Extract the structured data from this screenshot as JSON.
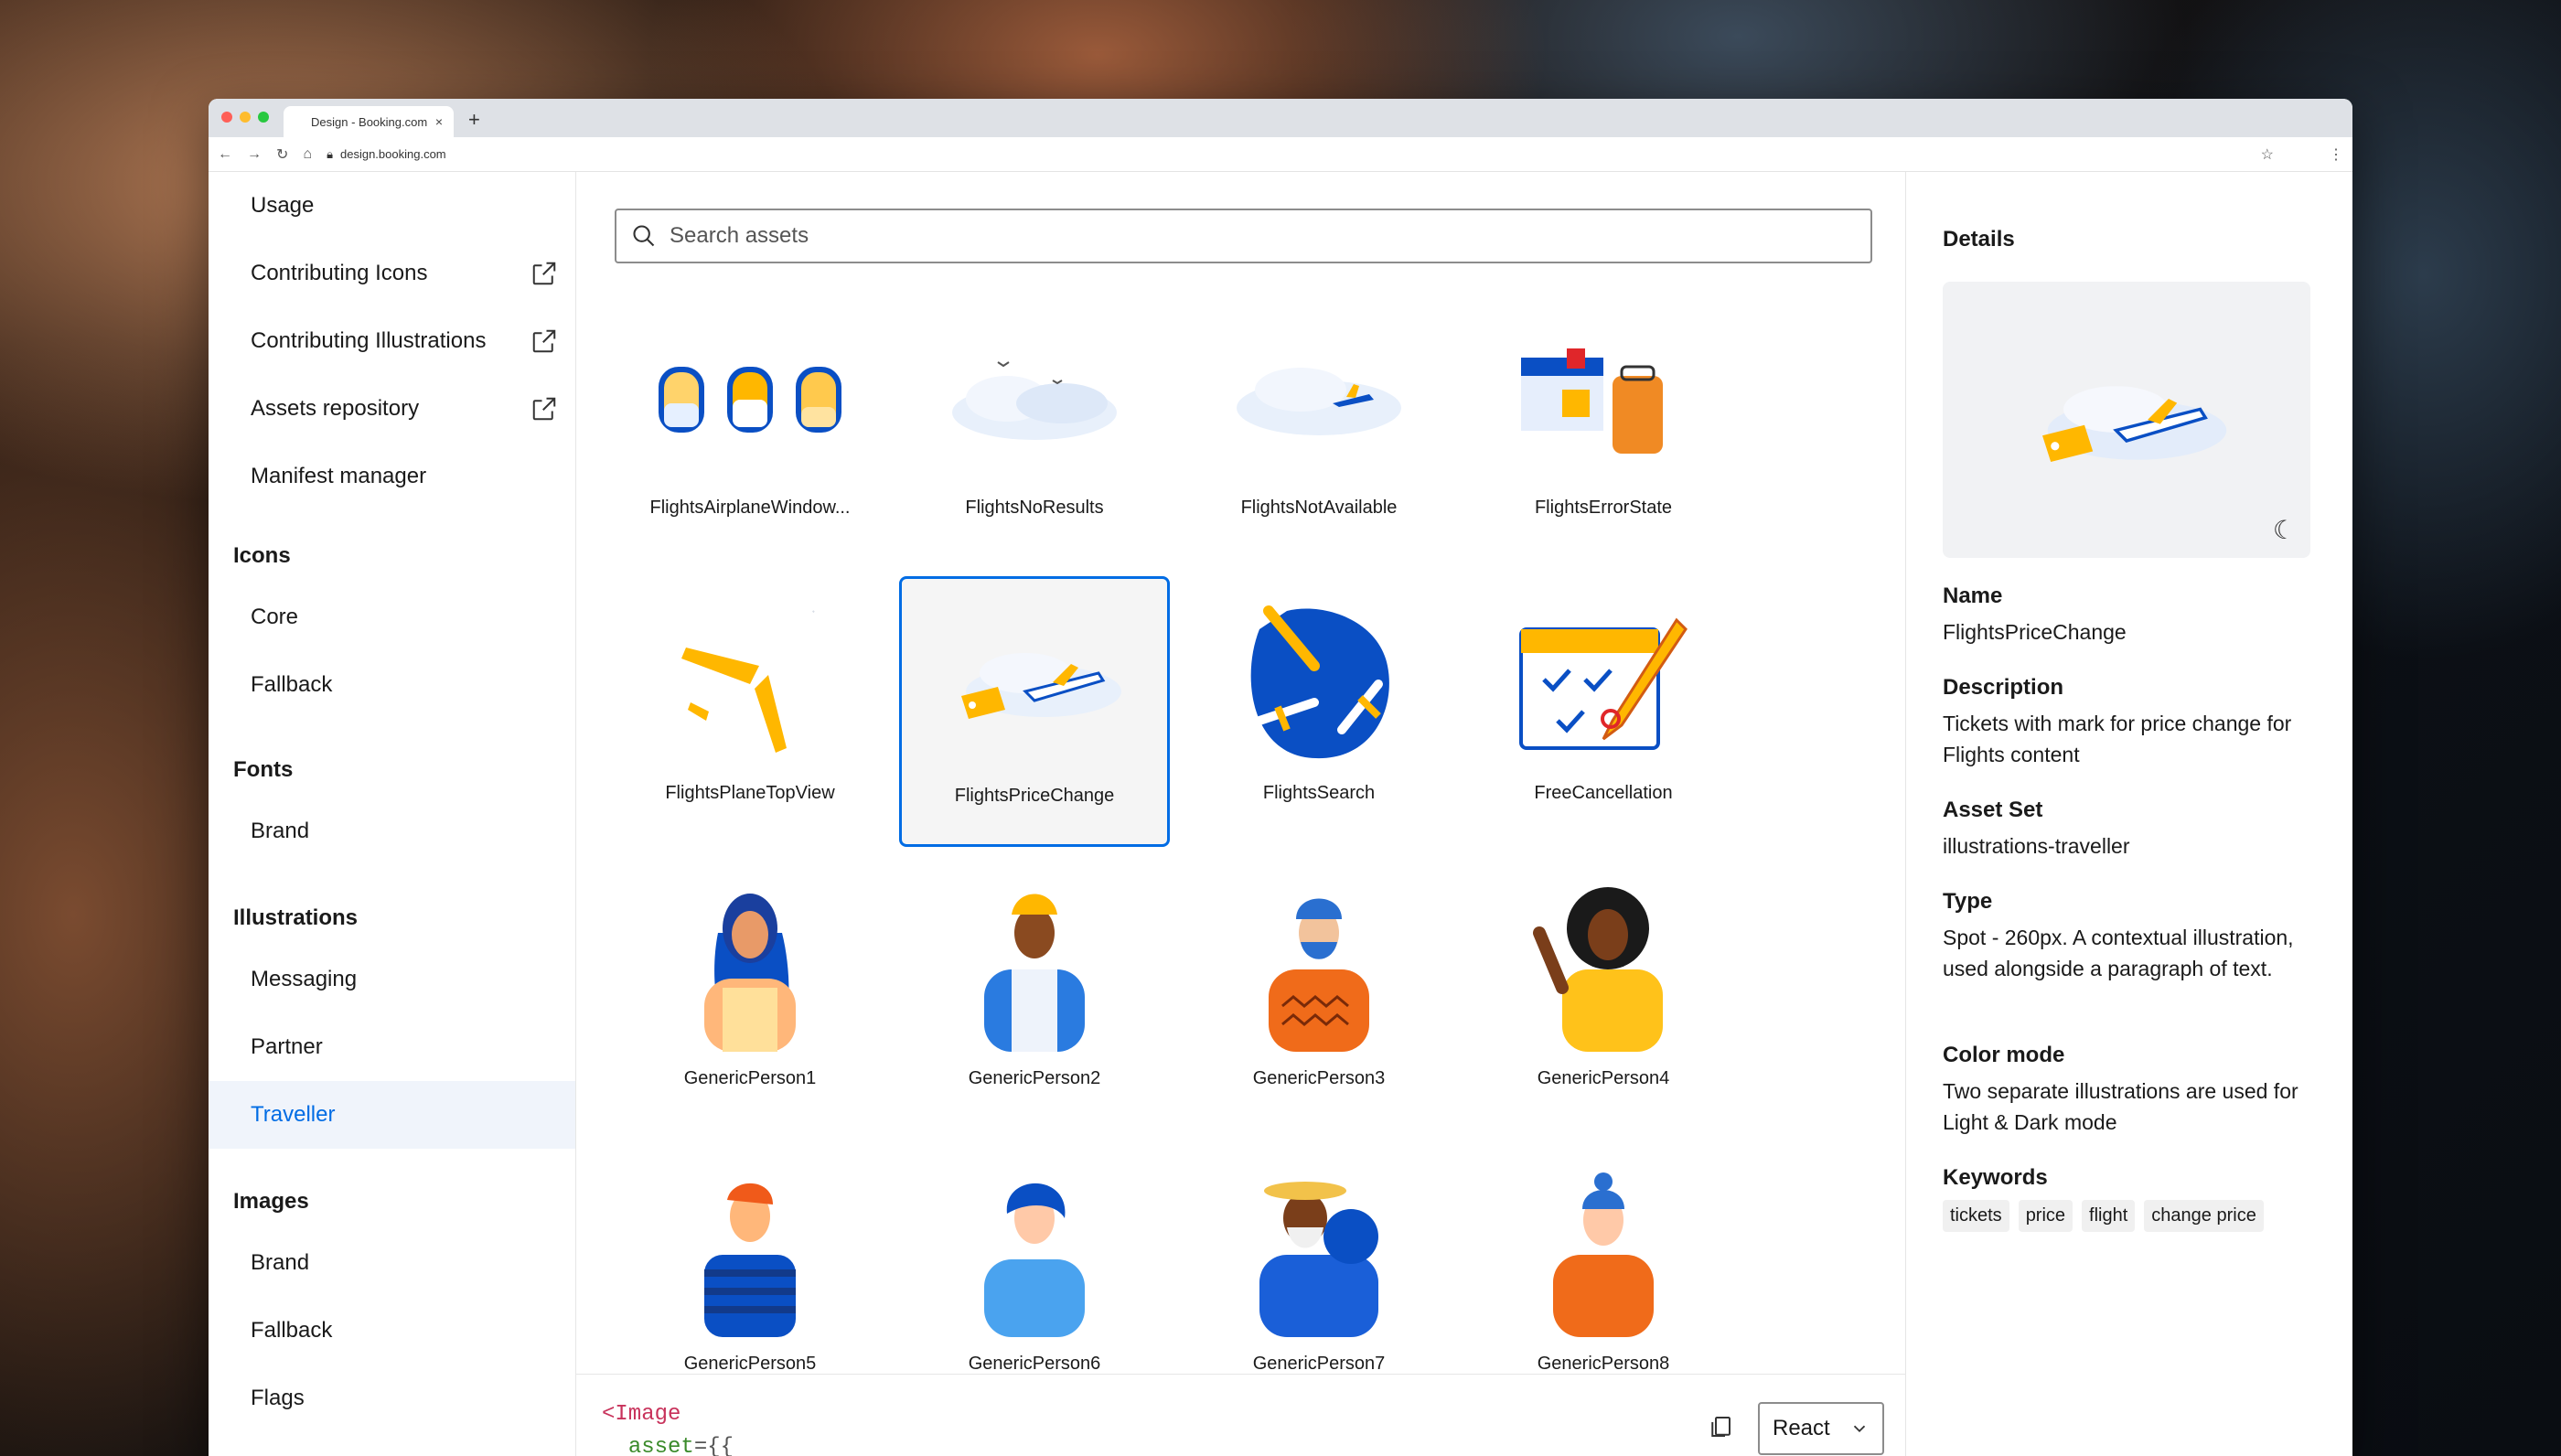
{
  "browser": {
    "tab_title": "Design - Booking.com",
    "tab_close": "×",
    "new_tab": "+",
    "url": "design.booking.com"
  },
  "sidebar": {
    "top_items": [
      {
        "label": "Usage"
      },
      {
        "label": "Contributing Icons"
      },
      {
        "label": "Contributing Illustrations"
      },
      {
        "label": "Assets repository"
      },
      {
        "label": "Manifest manager"
      }
    ],
    "sections": [
      {
        "title": "Icons",
        "items": [
          "Core",
          "Fallback"
        ]
      },
      {
        "title": "Fonts",
        "items": [
          "Brand"
        ]
      },
      {
        "title": "Illustrations",
        "items": [
          "Messaging",
          "Partner",
          "Traveller"
        ]
      },
      {
        "title": "Images",
        "items": [
          "Brand",
          "Fallback",
          "Flags"
        ]
      }
    ],
    "active": "Traveller"
  },
  "search": {
    "placeholder": "Search assets"
  },
  "assets": [
    {
      "name": "FlightsAirplaneWindow...",
      "icon": "airplane-windows"
    },
    {
      "name": "FlightsNoResults",
      "icon": "clouds"
    },
    {
      "name": "FlightsNotAvailable",
      "icon": "cloud-plane"
    },
    {
      "name": "FlightsErrorState",
      "icon": "error-luggage"
    },
    {
      "name": "FlightsPlaneTopView",
      "icon": "plane-top"
    },
    {
      "name": "FlightsPriceChange",
      "icon": "price-change",
      "selected": true
    },
    {
      "name": "FlightsSearch",
      "icon": "search-planes"
    },
    {
      "name": "FreeCancellation",
      "icon": "calendar-check"
    },
    {
      "name": "GenericPerson1",
      "icon": "person"
    },
    {
      "name": "GenericPerson2",
      "icon": "person"
    },
    {
      "name": "GenericPerson3",
      "icon": "person"
    },
    {
      "name": "GenericPerson4",
      "icon": "person"
    },
    {
      "name": "GenericPerson5",
      "icon": "person"
    },
    {
      "name": "GenericPerson6",
      "icon": "person"
    },
    {
      "name": "GenericPerson7",
      "icon": "person"
    },
    {
      "name": "GenericPerson8",
      "icon": "person"
    }
  ],
  "code": {
    "line1_tag": "<Image",
    "line2_attr": "asset",
    "line2_rest": "={{"
  },
  "framework": {
    "selected": "React"
  },
  "details": {
    "title": "Details",
    "name_label": "Name",
    "name_value": "FlightsPriceChange",
    "description_label": "Description",
    "description_value": "Tickets with mark for price change for Flights content",
    "asset_set_label": "Asset Set",
    "asset_set_value": "illustrations-traveller",
    "type_label": "Type",
    "type_value": "Spot - 260px. A contextual illustration, used alongside a paragraph of text.",
    "color_mode_label": "Color mode",
    "color_mode_value": "Two separate illustrations are used for Light & Dark mode",
    "keywords_label": "Keywords",
    "keywords": [
      "tickets",
      "price",
      "flight",
      "change price"
    ]
  },
  "colors": {
    "accent": "#006ce4",
    "brand_yellow": "#ffb700",
    "brand_blue": "#0a4fc4"
  }
}
